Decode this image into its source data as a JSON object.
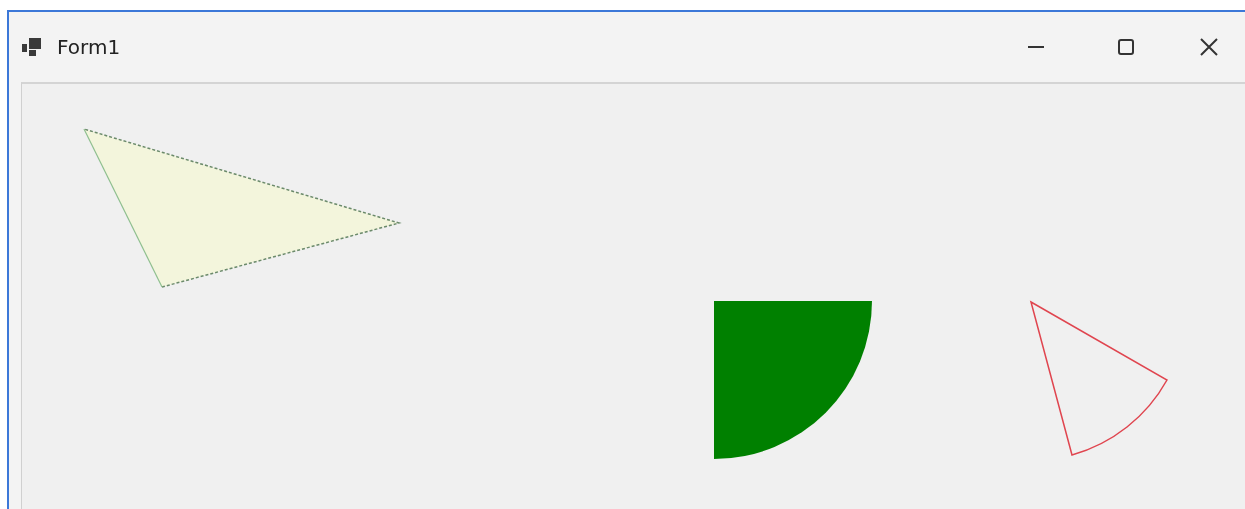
{
  "window": {
    "title": "Form1"
  },
  "title_buttons": [
    {
      "kind": "minimize"
    },
    {
      "kind": "maximize"
    },
    {
      "kind": "close"
    }
  ],
  "shapes": [
    {
      "kind": "dashed-triangle"
    },
    {
      "kind": "filled-quarter-circle"
    },
    {
      "kind": "outlined-pie-slice"
    }
  ]
}
